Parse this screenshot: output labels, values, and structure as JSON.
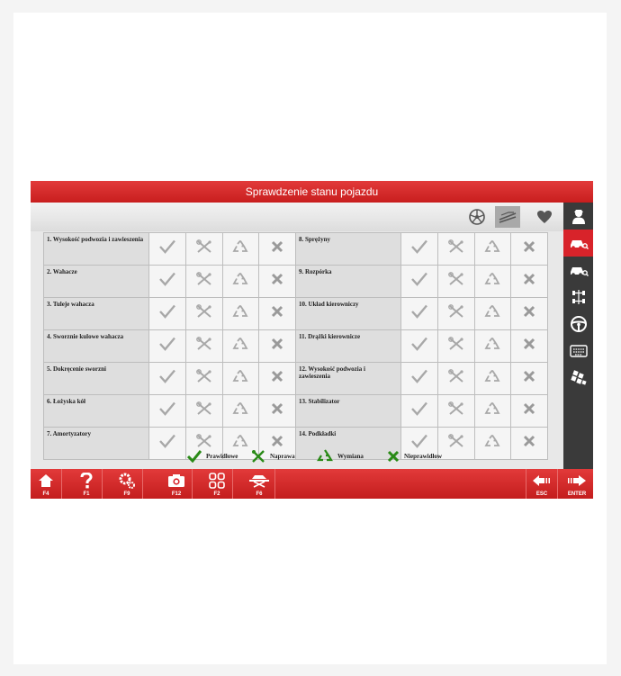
{
  "window": {
    "title": "Sprawdzenie stanu pojazdu"
  },
  "toolbar": {
    "icons": [
      "wheel-icon",
      "vehicle-check-icon",
      "heart-icon"
    ]
  },
  "sidebar": {
    "icons": [
      "mechanic-icon",
      "car-key-icon",
      "car-search-icon",
      "alignment-icon",
      "steering-wheel-icon",
      "keyboard-icon",
      "calibration-icon"
    ]
  },
  "checks": {
    "left": [
      "1. Wysokość podwozia i zawieszenia",
      "2. Wahacze",
      "3. Tuleje wahacza",
      "4. Sworznie kulowe wahacza",
      "5. Dokręcenie sworzni",
      "6. Łożyska kół",
      "7. Amortyzatory"
    ],
    "right": [
      "8. Sprężyny",
      "9. Rozpórka",
      "10. Układ kierowniczy",
      "11. Drążki kierownicze",
      "12. Wysokość podwozia i zawieszenia",
      "13. Stabilizator",
      "14. Podkładki"
    ]
  },
  "legend": {
    "ok": "Prawidłowe",
    "repair": "Naprawa",
    "replace": "Wymiana",
    "wrong": "Nieprawidłow"
  },
  "fkeys": {
    "home": "F4",
    "help": "F1",
    "settings": "F9",
    "camera": "F12",
    "menu": "F2",
    "lift": "F6",
    "esc": "ESC",
    "enter": "ENTER"
  },
  "colors": {
    "accent": "#d8232a",
    "sidebar": "#3a3a3a",
    "ok_green": "#2a8a17"
  }
}
